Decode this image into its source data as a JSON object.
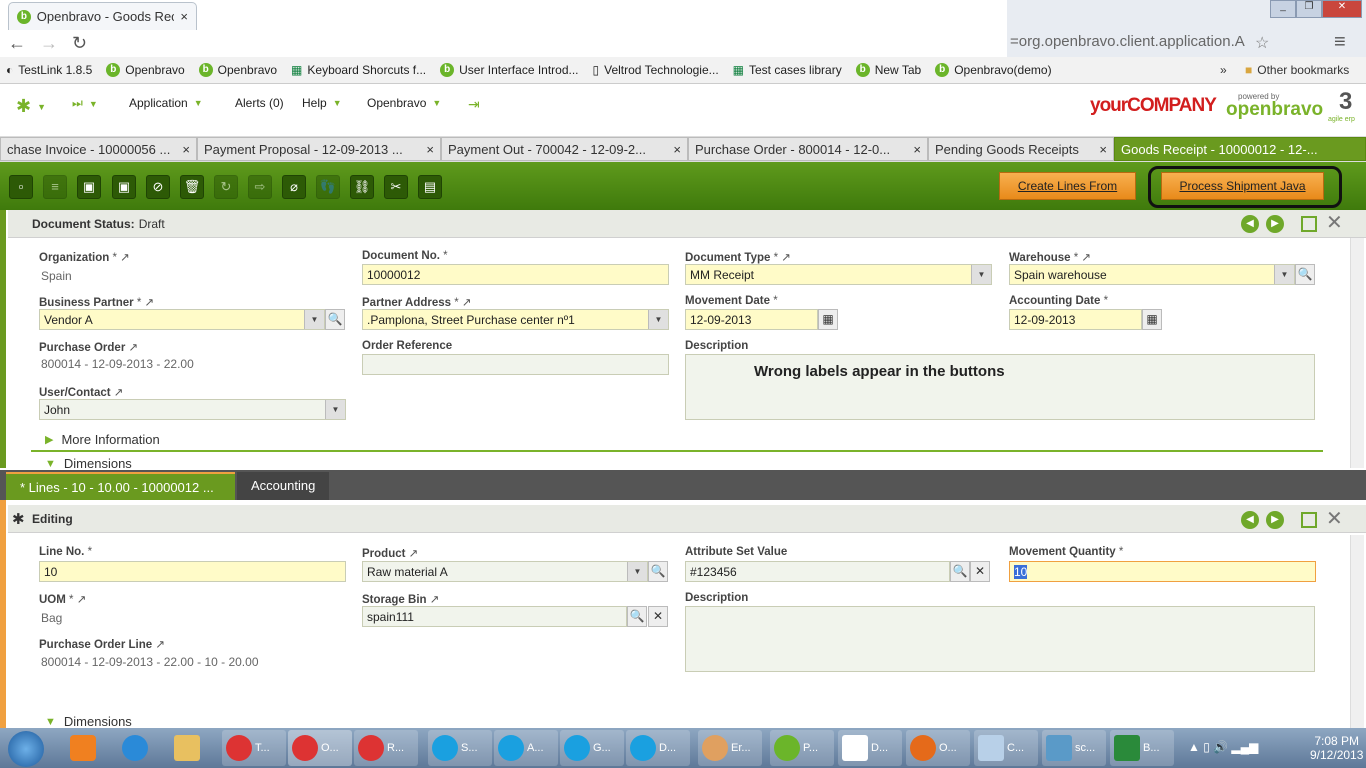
{
  "browser": {
    "tab_title": "Openbravo - Goods Receipt",
    "url_fragment": "=org.openbravo.client.application.A",
    "bookmarks": [
      "TestLink 1.8.5",
      "Openbravo",
      "Openbravo",
      "Keyboard Shorcuts f...",
      "User Interface Introd...",
      "Veltrod Technologie...",
      "Test cases library",
      "New Tab",
      "Openbravo(demo)"
    ],
    "more": "»",
    "other_bookmarks": "Other bookmarks"
  },
  "nav": {
    "application": "Application",
    "alerts": "Alerts (0)",
    "help": "Help",
    "openbravo": "Openbravo",
    "brand": "yourCOMPANY",
    "powered": "powered by",
    "ob_brand": "openbravo",
    "ob_version": "3",
    "tagline": "agile erp"
  },
  "window_tabs": [
    {
      "label": "chase Invoice - 10000056 ..."
    },
    {
      "label": "Payment Proposal - 12-09-2013 ..."
    },
    {
      "label": "Payment Out - 700042 - 12-09-2..."
    },
    {
      "label": "Purchase Order - 800014 - 12-0..."
    },
    {
      "label": "Pending Goods Receipts"
    },
    {
      "label": "Goods Receipt - 10000012 - 12-..."
    }
  ],
  "toolbar": {
    "create_lines": "Create Lines From",
    "process_shipment": "Process Shipment Java"
  },
  "header": {
    "status_label": "Document Status:",
    "status_value": "Draft",
    "fields": {
      "organization": {
        "label": "Organization",
        "value": "Spain"
      },
      "document_no": {
        "label": "Document No.",
        "value": "10000012"
      },
      "document_type": {
        "label": "Document Type",
        "value": "MM Receipt"
      },
      "warehouse": {
        "label": "Warehouse",
        "value": "Spain warehouse"
      },
      "business_partner": {
        "label": "Business Partner",
        "value": "Vendor A"
      },
      "partner_address": {
        "label": "Partner Address",
        "value": ".Pamplona, Street Purchase center nº1"
      },
      "movement_date": {
        "label": "Movement Date",
        "value": "12-09-2013"
      },
      "accounting_date": {
        "label": "Accounting Date",
        "value": "12-09-2013"
      },
      "purchase_order": {
        "label": "Purchase Order",
        "value": "800014 - 12-09-2013 - 22.00"
      },
      "order_reference": {
        "label": "Order Reference",
        "value": ""
      },
      "description": {
        "label": "Description",
        "value": "Wrong labels appear in the buttons"
      },
      "user_contact": {
        "label": "User/Contact",
        "value": "John"
      }
    },
    "more_info": "More Information",
    "dimensions": "Dimensions"
  },
  "subtabs": {
    "lines": "* Lines - 10 - 10.00 - 10000012 ...",
    "accounting": "Accounting"
  },
  "lines": {
    "status": "Editing",
    "fields": {
      "line_no": {
        "label": "Line No.",
        "value": "10"
      },
      "product": {
        "label": "Product",
        "value": "Raw material A"
      },
      "attribute_set": {
        "label": "Attribute Set Value",
        "value": "#123456"
      },
      "movement_qty": {
        "label": "Movement Quantity",
        "value": "10"
      },
      "uom": {
        "label": "UOM",
        "value": "Bag"
      },
      "storage_bin": {
        "label": "Storage Bin",
        "value": "spain111"
      },
      "description": {
        "label": "Description",
        "value": ""
      },
      "po_line": {
        "label": "Purchase Order Line",
        "value": "800014 - 12-09-2013 - 22.00 - 10 - 20.00"
      }
    },
    "dimensions": "Dimensions"
  },
  "taskbar": {
    "items": [
      "T...",
      "O...",
      "R...",
      "S...",
      "A...",
      "G...",
      "D...",
      "Er...",
      "P...",
      "D...",
      "O...",
      "C...",
      "sc...",
      "B..."
    ],
    "time": "7:08 PM",
    "date": "9/12/2013"
  },
  "colors": {
    "accent_green": "#5f9a1c",
    "orange": "#f0a040"
  }
}
